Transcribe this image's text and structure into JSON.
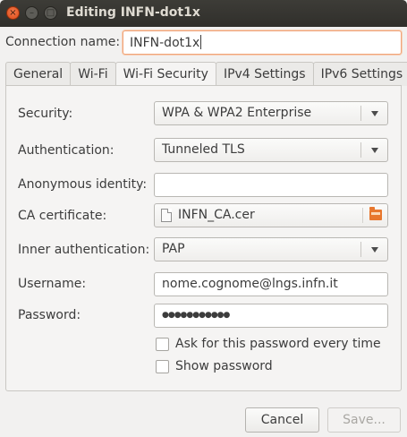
{
  "window": {
    "title": "Editing INFN-dot1x",
    "close_glyph": "×",
    "minimize_glyph": "–",
    "maximize_glyph": "□"
  },
  "connection": {
    "label": "Connection name:",
    "value": "INFN-dot1x"
  },
  "tabs": [
    {
      "label": "General"
    },
    {
      "label": "Wi-Fi"
    },
    {
      "label": "Wi-Fi Security"
    },
    {
      "label": "IPv4 Settings"
    },
    {
      "label": "IPv6 Settings"
    }
  ],
  "active_tab": "Wi-Fi Security",
  "form": {
    "security": {
      "label": "Security:",
      "value": "WPA & WPA2 Enterprise"
    },
    "authentication": {
      "label": "Authentication:",
      "value": "Tunneled TLS"
    },
    "anonymous_identity": {
      "label": "Anonymous identity:",
      "value": ""
    },
    "ca_certificate": {
      "label": "CA certificate:",
      "value": "INFN_CA.cer"
    },
    "inner_authentication": {
      "label": "Inner authentication:",
      "value": "PAP"
    },
    "username": {
      "label": "Username:",
      "value": "nome.cognome@lngs.infn.it"
    },
    "password": {
      "label": "Password:",
      "value": "●●●●●●●●●●●"
    },
    "ask_password": {
      "label": "Ask for this password every time",
      "checked": false
    },
    "show_password": {
      "label": "Show password",
      "checked": false
    }
  },
  "buttons": {
    "cancel": "Cancel",
    "save": "Save..."
  },
  "icons": {
    "file": "file-icon",
    "folder": "folder-open-icon",
    "dropdown": "chevron-down-icon"
  },
  "colors": {
    "titlebar": "#302f2b",
    "close": "#de4a17",
    "focus_border": "#f0a57a",
    "background": "#f2f1f0"
  }
}
